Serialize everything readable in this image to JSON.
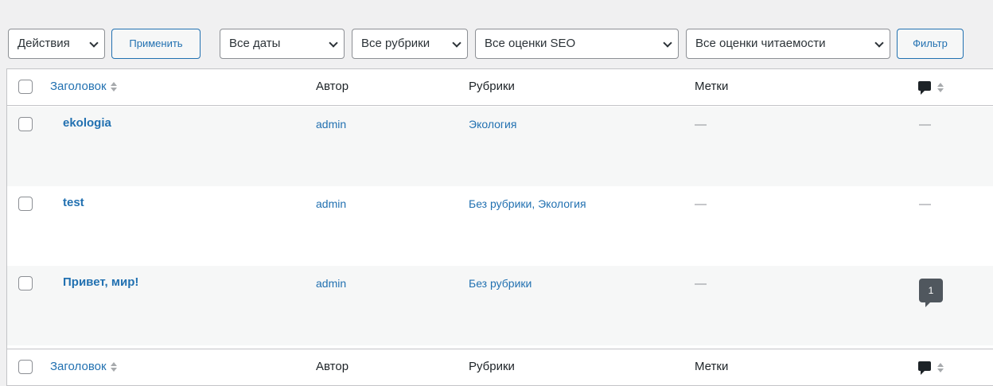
{
  "toolbar": {
    "bulk_actions": "Действия",
    "apply": "Применить",
    "dates": "Все даты",
    "categories": "Все рубрики",
    "seo": "Все оценки SEO",
    "readability": "Все оценки читаемости",
    "filter": "Фильтр"
  },
  "columns": {
    "title": "Заголовок",
    "author": "Автор",
    "categories": "Рубрики",
    "tags": "Метки"
  },
  "posts": [
    {
      "title": "ekologia",
      "author": "admin",
      "categories": "Экология",
      "tags": "—",
      "comments": "—"
    },
    {
      "title": "test",
      "author": "admin",
      "categories": "Без рубрики, Экология",
      "tags": "—",
      "comments": "—"
    },
    {
      "title": "Привет, мир!",
      "author": "admin",
      "categories": "Без рубрики",
      "tags": "—",
      "comments": "1"
    }
  ],
  "icons": {
    "comments_header": "comment-bubble-icon",
    "sort": "sort-arrows-icon",
    "dropdown": "chevron-down-icon"
  },
  "colors": {
    "link": "#2271b1",
    "alt_row": "#f6f7f7",
    "count_badge": "#50575e"
  }
}
